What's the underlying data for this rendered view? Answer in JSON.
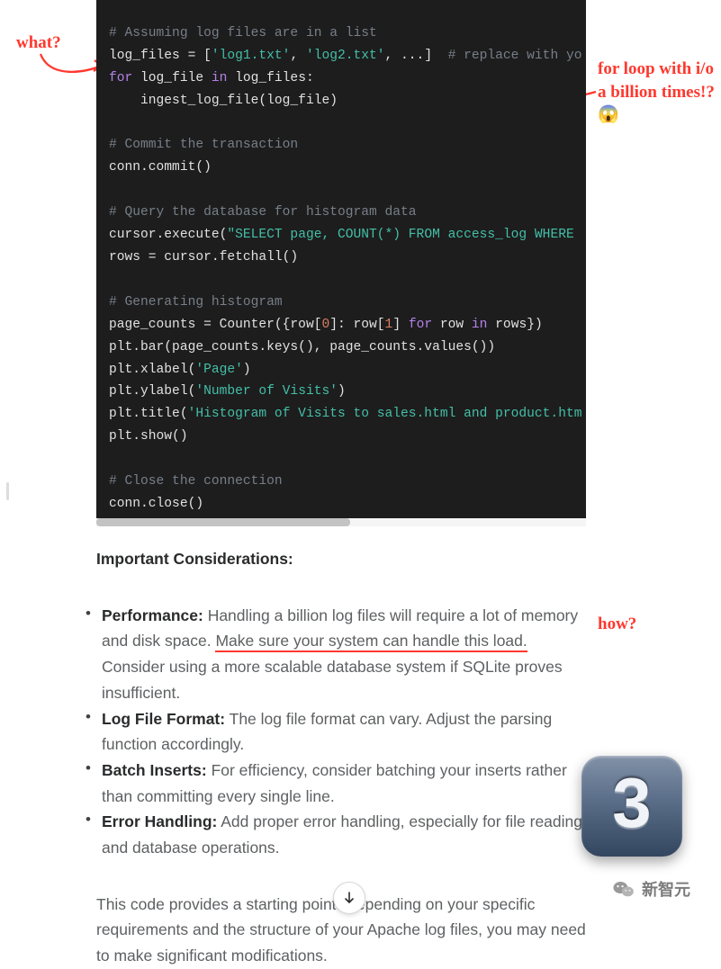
{
  "annotations": {
    "what": "what?",
    "loop": "for loop with i/o a billion times!? 😱",
    "how": "how?"
  },
  "code": {
    "lines": [
      [
        [
          "",
          ""
        ]
      ],
      [
        [
          "cm",
          "# Assuming log files are in a list"
        ]
      ],
      [
        [
          "d",
          "log_files = ["
        ],
        [
          "str",
          "'log1.txt'"
        ],
        [
          "d",
          ", "
        ],
        [
          "str",
          "'log2.txt'"
        ],
        [
          "d",
          ", ...]  "
        ],
        [
          "cm",
          "# replace with yo"
        ]
      ],
      [
        [
          "kw",
          "for"
        ],
        [
          "d",
          " log_file "
        ],
        [
          "kw",
          "in"
        ],
        [
          "d",
          " log_files:"
        ]
      ],
      [
        [
          "d",
          "    ingest_log_file(log_file)"
        ]
      ],
      [
        [
          "",
          ""
        ]
      ],
      [
        [
          "cm",
          "# Commit the transaction"
        ]
      ],
      [
        [
          "d",
          "conn.commit()"
        ]
      ],
      [
        [
          "",
          ""
        ]
      ],
      [
        [
          "cm",
          "# Query the database for histogram data"
        ]
      ],
      [
        [
          "d",
          "cursor.execute("
        ],
        [
          "str",
          "\"SELECT page, COUNT(*) FROM access_log WHERE "
        ]
      ],
      [
        [
          "d",
          "rows = cursor.fetchall()"
        ]
      ],
      [
        [
          "",
          ""
        ]
      ],
      [
        [
          "cm",
          "# Generating histogram"
        ]
      ],
      [
        [
          "d",
          "page_counts = Counter({row["
        ],
        [
          "num",
          "0"
        ],
        [
          "d",
          "]: row["
        ],
        [
          "num",
          "1"
        ],
        [
          "d",
          "] "
        ],
        [
          "kw",
          "for"
        ],
        [
          "d",
          " row "
        ],
        [
          "kw",
          "in"
        ],
        [
          "d",
          " rows})"
        ]
      ],
      [
        [
          "d",
          "plt.bar(page_counts.keys(), page_counts.values())"
        ]
      ],
      [
        [
          "d",
          "plt.xlabel("
        ],
        [
          "str",
          "'Page'"
        ],
        [
          "d",
          ")"
        ]
      ],
      [
        [
          "d",
          "plt.ylabel("
        ],
        [
          "str",
          "'Number of Visits'"
        ],
        [
          "d",
          ")"
        ]
      ],
      [
        [
          "d",
          "plt.title("
        ],
        [
          "str",
          "'Histogram of Visits to sales.html and product.htm"
        ]
      ],
      [
        [
          "d",
          "plt.show()"
        ]
      ],
      [
        [
          "",
          ""
        ]
      ],
      [
        [
          "cm",
          "# Close the connection"
        ]
      ],
      [
        [
          "d",
          "conn.close()"
        ]
      ]
    ]
  },
  "text": {
    "heading": "Important Considerations:",
    "items": [
      {
        "label": "Performance:",
        "body_a": " Handling a billion log files will require a lot of memory and disk space. ",
        "underline": "Make sure your system can handle this load.",
        "body_b": " Consider using a more scalable database system if SQLite proves insufficient."
      },
      {
        "label": "Log File Format:",
        "body_a": " The log file format can vary. Adjust the parsing function accordingly.",
        "underline": "",
        "body_b": ""
      },
      {
        "label": "Batch Inserts:",
        "body_a": " For efficiency, consider batching your inserts rather than committing every single line.",
        "underline": "",
        "body_b": ""
      },
      {
        "label": "Error Handling:",
        "body_a": " Add proper error handling, especially for file reading and database operations.",
        "underline": "",
        "body_b": ""
      }
    ],
    "outro": "This code provides a starting point. Depending on your specific requirements and the structure of your Apache log files, you may need to make significant modifications."
  },
  "badge": {
    "label": "3"
  },
  "watermark": {
    "label": "新智元"
  }
}
